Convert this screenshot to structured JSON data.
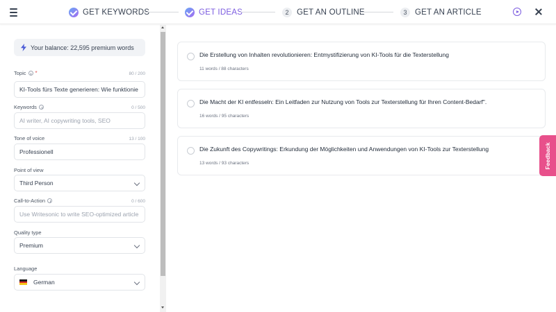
{
  "colors": {
    "accent": "#7c5ce0",
    "feedback": "#e8508b"
  },
  "icons": {
    "menu": "hamburger-menu-icon",
    "check": "check-circle-icon",
    "play": "play-circle-icon",
    "close": "close-icon",
    "bolt": "lightning-bolt-icon",
    "info": "info-icon",
    "chevron": "chevron-down-icon",
    "flag": "german-flag-icon"
  },
  "steps": [
    {
      "label": "GET KEYWORDS",
      "state": "done"
    },
    {
      "label": "GET IDEAS",
      "state": "active"
    },
    {
      "number": "2",
      "label": "GET AN OUTLINE",
      "state": "pending"
    },
    {
      "number": "3",
      "label": "GET AN ARTICLE",
      "state": "pending"
    }
  ],
  "balance": {
    "text": "Your balance: 22,595 premium words"
  },
  "form": {
    "topic": {
      "label": "Topic",
      "required_mark": "*",
      "counter": "80 / 200",
      "value": "KI-Tools fürs Texte generieren: Wie funktionie"
    },
    "keywords": {
      "label": "Keywords",
      "counter": "0 / 500",
      "placeholder": "AI writer, AI copywriting tools, SEO"
    },
    "tone": {
      "label": "Tone of voice",
      "counter": "13 / 100",
      "value": "Professionell"
    },
    "point_of_view": {
      "label": "Point of view",
      "value": "Third Person"
    },
    "cta": {
      "label": "Call-to-Action",
      "counter": "0 / 600",
      "placeholder": "Use Writesonic to write SEO-optimized article"
    },
    "quality": {
      "label": "Quality type",
      "value": "Premium"
    },
    "language": {
      "label": "Language",
      "value": "German"
    }
  },
  "ideas": [
    {
      "title": "Die Erstellung von Inhalten revolutionieren: Entmystifizierung von KI-Tools für die Texterstellung",
      "meta": "11 words / 88 characters"
    },
    {
      "title": "Die Macht der KI entfesseln: Ein Leitfaden zur Nutzung von Tools zur Texterstellung für Ihren Content-Bedarf\".",
      "meta": "16 words / 95 characters"
    },
    {
      "title": "Die Zukunft des Copywritings: Erkundung der Möglichkeiten und Anwendungen von KI-Tools zur Texterstellung",
      "meta": "13 words / 93 characters"
    }
  ],
  "feedback": {
    "label": "Feedback"
  }
}
